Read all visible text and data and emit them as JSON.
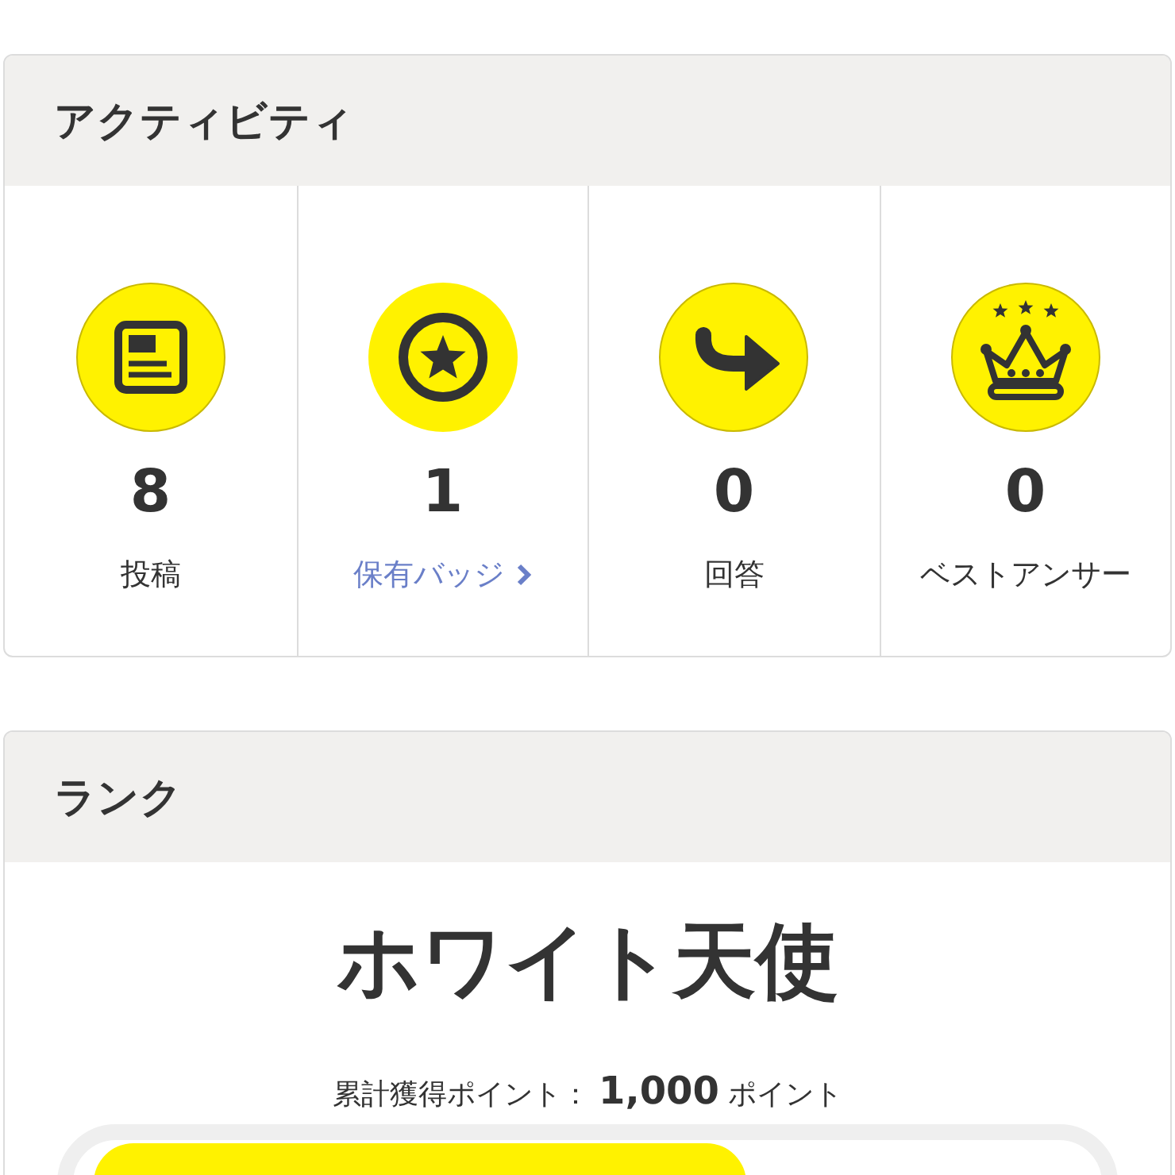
{
  "activity": {
    "title": "アクティビティ",
    "items": [
      {
        "kind": "post",
        "count": "8",
        "label": "投稿",
        "link": false
      },
      {
        "kind": "badge",
        "count": "1",
        "label": "保有バッジ",
        "link": true
      },
      {
        "kind": "answer",
        "count": "0",
        "label": "回答",
        "link": false
      },
      {
        "kind": "best",
        "count": "0",
        "label": "ベストアンサー",
        "link": false
      }
    ]
  },
  "rank": {
    "title": "ランク",
    "name": "ホワイト天使",
    "points": "累計獲得ポイント： **1,000** ポイント",
    "progress": {
      "level": 0.66
    }
  }
}
